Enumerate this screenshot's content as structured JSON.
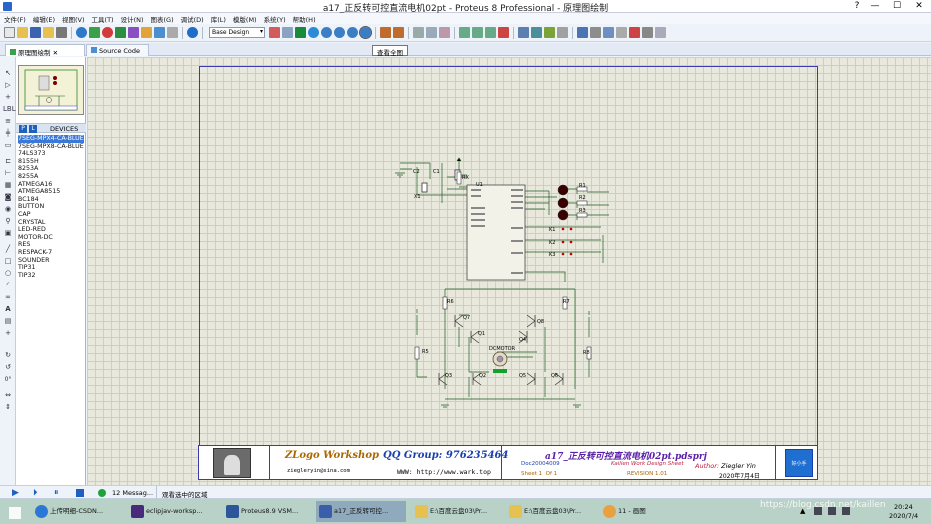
{
  "window": {
    "title": "a17_正反转可控直流电机02pt - Proteus 8 Professional - 原理图绘制",
    "help": "?",
    "minimize": "—",
    "maximize": "☐",
    "close": "✕"
  },
  "menu": [
    "文件(F)",
    "编辑(E)",
    "视图(V)",
    "工具(T)",
    "设计(N)",
    "图表(G)",
    "调试(D)",
    "库(L)",
    "模版(M)",
    "系统(Y)",
    "帮助(H)"
  ],
  "toolbar": {
    "design_select": "Base Design",
    "tooltip": "查看全图"
  },
  "tabs": [
    {
      "label": "原理图绘制",
      "close": "✕"
    },
    {
      "label": "Source Code",
      "close": "✕"
    }
  ],
  "devices": {
    "pick_p": "P",
    "pick_l": "L",
    "header": "DEVICES",
    "selected_index": 0,
    "items": [
      "7SEG-MPX4-CA-BLUE",
      "7SEG-MPX8-CA-BLUE",
      "74LS373",
      "8155H",
      "8253A",
      "8255A",
      "ATMEGA16",
      "ATMEGA8515",
      "BC184",
      "BUTTON",
      "CAP",
      "CRYSTAL",
      "LED-RED",
      "MOTOR-DC",
      "RES",
      "RESPACK-7",
      "SOUNDER",
      "TIP31",
      "TIP32"
    ]
  },
  "lefttools": {
    "rotate_value": "0°"
  },
  "schematic": {
    "labels": {
      "C2": "C2",
      "C1": "C1",
      "X1": "X1",
      "RX": "RX",
      "U1": "U1",
      "R1": "R1",
      "R2": "R2",
      "R3": "R3",
      "K1": "K1",
      "K2": "K2",
      "K3": "K3",
      "R6": "R6",
      "R7": "R7",
      "Q7": "Q7",
      "Q8": "Q8",
      "Q1": "Q1",
      "Q4": "Q4",
      "R5": "R5",
      "R8": "R8",
      "DCMOTOR": "DCMOTOR",
      "Q3": "Q3",
      "Q2": "Q2",
      "Q5": "Q5",
      "Q6": "Q6"
    }
  },
  "titleblock": {
    "workshop": "ZLogo Workshop",
    "qq": "QQ Group: 976235464",
    "email": "ziegleryin@sina.com",
    "www": "WWW: http://www.wark.top",
    "design_title": "a17_正反转可控直流电机02pt.pdsprj",
    "doc": "Doc20004009",
    "company": "Kailien Work Design Sheet",
    "author_label": "Author:",
    "author": "Ziegler Yin",
    "sheet_label": "Sheet",
    "sheet": "1",
    "of_label": "Of",
    "of": "1",
    "revision_label": "REVISION",
    "revision": "1.01",
    "date": "2020年7月4日",
    "logo_text": "好小手"
  },
  "status": {
    "messages": "12 Messag...",
    "hint": "观看选中的区域"
  },
  "taskbar": {
    "items": [
      "上传明细-CSDN...",
      "eclipjav-worksp...",
      "Proteus8.9 VSM...",
      "a17_正反转可控...",
      "E:\\百度云盘03\\Pr...",
      "E:\\百度云盘03\\Pr...",
      "11 - 画图"
    ],
    "active_index": 3,
    "time": "20:24",
    "date": "2020/7/4",
    "watermark": "https://blog.csdn.net/kaillen"
  },
  "colors": {
    "wire": "#1f5f1f",
    "led": "#7a0000",
    "border": "#3b3bb0",
    "accent": "#3a79d8"
  }
}
